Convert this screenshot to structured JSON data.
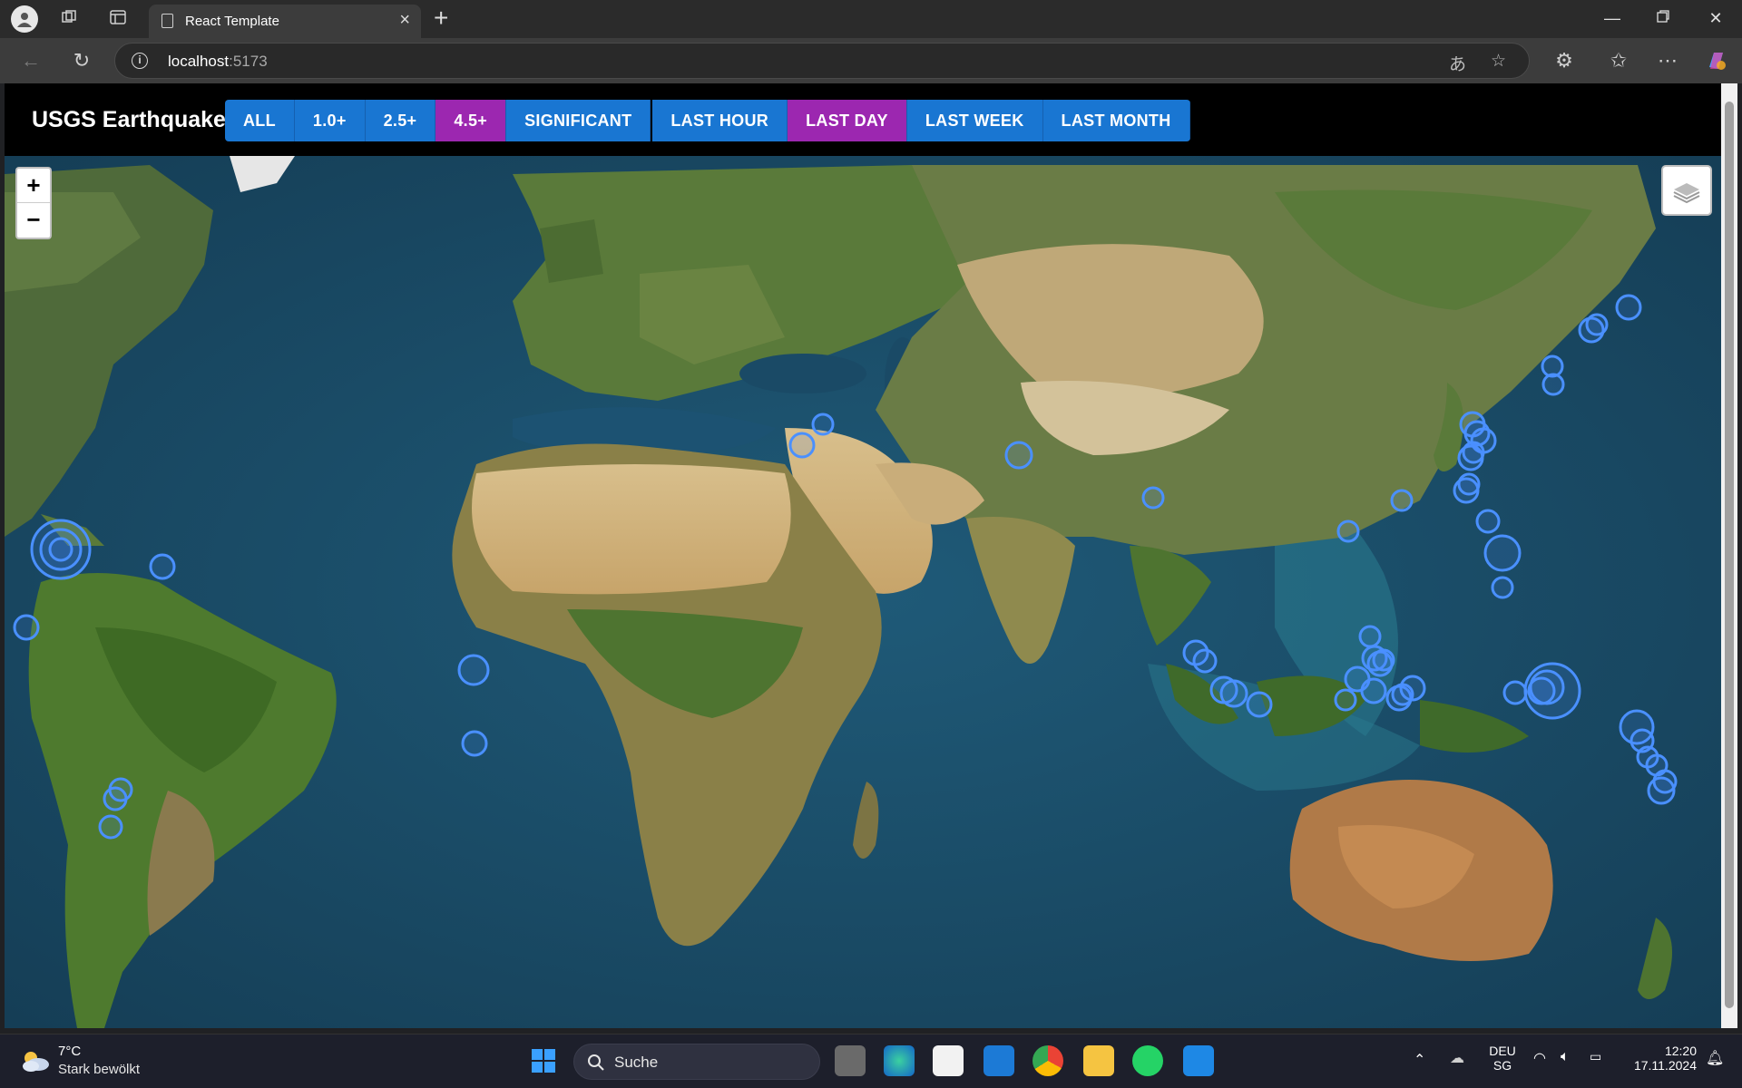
{
  "browser": {
    "tab_title": "React Template",
    "url_host": "localhost",
    "url_port": ":5173"
  },
  "app": {
    "title": "USGS Earthquakes",
    "magnitude_filters": [
      {
        "label": "ALL",
        "active": false
      },
      {
        "label": "1.0+",
        "active": false
      },
      {
        "label": "2.5+",
        "active": false
      },
      {
        "label": "4.5+",
        "active": true
      },
      {
        "label": "SIGNIFICANT",
        "active": false
      }
    ],
    "time_filters": [
      {
        "label": "LAST HOUR",
        "active": false
      },
      {
        "label": "LAST DAY",
        "active": true
      },
      {
        "label": "LAST WEEK",
        "active": false
      },
      {
        "label": "LAST MONTH",
        "active": false
      }
    ],
    "accent_color": "#1976d2",
    "active_color": "#9c27b0",
    "marker_color": "#4a90ff"
  },
  "map": {
    "zoom_in_label": "+",
    "zoom_out_label": "−",
    "layers_icon": "layers-icon"
  },
  "taskbar": {
    "weather_temp": "7°C",
    "weather_desc": "Stark bewölkt",
    "search_placeholder": "Suche",
    "language": "DEU",
    "language_sub": "SG",
    "time": "12:20",
    "date": "17.11.2024"
  }
}
